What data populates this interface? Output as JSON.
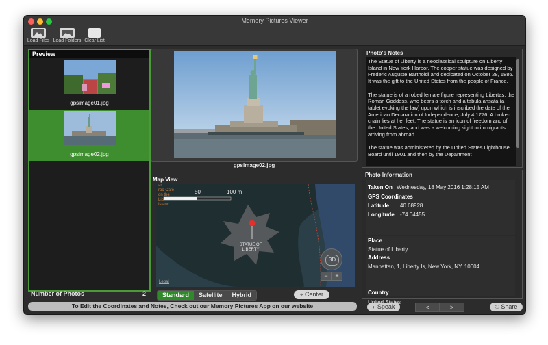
{
  "window": {
    "title": "Memory Pictures Viewer"
  },
  "toolbar": {
    "load_files": "Load Files",
    "load_folders": "Load Folders",
    "clear_list": "Clear List"
  },
  "preview": {
    "header": "Preview",
    "items": [
      {
        "name": "gpsimage01.jpg"
      },
      {
        "name": "gpsimage02.jpg"
      }
    ],
    "count_label": "Number of Photos",
    "count_value": "2"
  },
  "viewer": {
    "file_name": "gpsimage02.jpg"
  },
  "map": {
    "title": "Map View",
    "scale_50": "50",
    "scale_100": "100 m",
    "poi_label": "Statue of Liberty",
    "poi_lines": [
      "STATUE OF",
      "LIBERTY"
    ],
    "cafe_lines": [
      "ar",
      "roo Cafe",
      "on the",
      "Lib",
      "Island"
    ],
    "legal": "Legal",
    "button_3d": "3D",
    "zoom_out": "−",
    "zoom_in": "+",
    "modes": [
      "Standard",
      "Satellite",
      "Hybrid"
    ],
    "selected_mode": "Standard",
    "center_label": "Center"
  },
  "banner": "To Edit the Coordinates and Notes, Check out our Memory Pictures App on our website",
  "notes": {
    "title": "Photo's Notes",
    "paragraphs": [
      "The Statue of Liberty is a neoclassical sculpture on Liberty Island in New York Harbor. The copper statue was designed by Frederic Auguste Bartholdi and dedicated on October 28, 1886. It was the gift to the United States from the people of France.",
      "The statue is of a robed female figure representing Libertas, the Roman Goddess, who bears a torch and a tabula ansata (a tablet evoking the law) upon which is inscribed the date of the American Declaration of Independence, July 4 1776. A broken chain lies at her feet. The statue is an icon of freedom and of the United States, and was a welcoming sight to immigrants arriving from abroad.",
      "The statue was administered by the United States Lighthouse Board until 1901 and then by the Department"
    ]
  },
  "info": {
    "title": "Photo Information",
    "taken_on_label": "Taken On",
    "taken_on_value": "Wednesday, 18 May 2016 1:28:15 AM",
    "gps_label": "GPS Coordinates",
    "latitude_label": "Latitude",
    "latitude_value": "40.68928",
    "longitude_label": "Longitude",
    "longitude_value": "-74.04455",
    "place_label": "Place",
    "place_value": "Statue of Liberty",
    "address_label": "Address",
    "address_value": "Manhattan, 1, Liberty Is, New York, NY, 10004",
    "country_label": "Country",
    "country_value": "United States"
  },
  "bottom": {
    "speak": "Speak",
    "prev": "<",
    "next": ">",
    "share": "Share"
  }
}
